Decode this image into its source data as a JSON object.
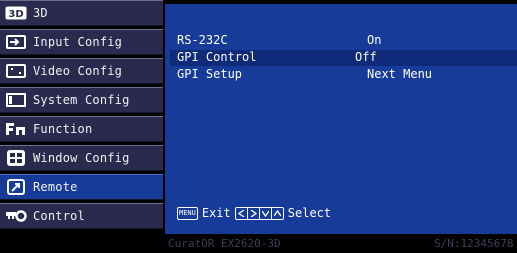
{
  "sidebar": {
    "items": [
      {
        "label": "3D",
        "icon": "3d-icon"
      },
      {
        "label": "Input Config",
        "icon": "input-icon"
      },
      {
        "label": "Video Config",
        "icon": "video-icon"
      },
      {
        "label": "System Config",
        "icon": "system-icon"
      },
      {
        "label": "Function",
        "icon": "function-icon"
      },
      {
        "label": "Window Config",
        "icon": "window-icon"
      },
      {
        "label": "Remote",
        "icon": "remote-icon",
        "active": true
      },
      {
        "label": "Control",
        "icon": "control-icon"
      }
    ]
  },
  "main": {
    "rows": [
      {
        "key": "RS-232C",
        "value": "On"
      },
      {
        "key": "GPI Control",
        "value": "Off"
      },
      {
        "key": "GPI Setup",
        "value": "Next Menu"
      }
    ],
    "hint": {
      "menu_key": "MENU",
      "exit_label": "Exit",
      "select_label": "Select"
    }
  },
  "footer": {
    "model": "CuratOR EX2620-3D",
    "serial": "S/N:12345678"
  },
  "colors": {
    "sidebar_bg": "#2a2a4f",
    "active_bg": "#163b98",
    "panel_bg": "#163b98",
    "footer_text": "#3e3e5c"
  }
}
